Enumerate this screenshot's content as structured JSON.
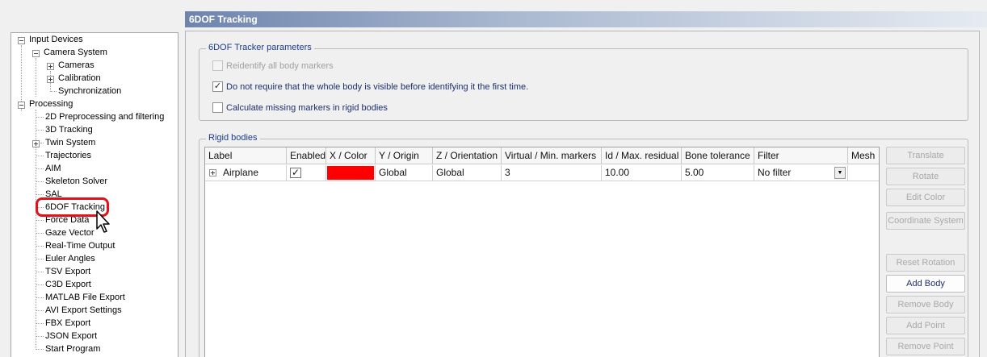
{
  "header": {
    "title": "6DOF Tracking"
  },
  "tree": {
    "input_devices": "Input Devices",
    "camera_system": "Camera System",
    "cameras": "Cameras",
    "calibration": "Calibration",
    "synchronization": "Synchronization",
    "processing": "Processing",
    "items": [
      "2D Preprocessing and filtering",
      "3D Tracking",
      "Twin System",
      "Trajectories",
      "AIM",
      "Skeleton Solver",
      "SAL",
      "6DOF Tracking",
      "Force Data",
      "Gaze Vector",
      "Real-Time Output",
      "Euler Angles",
      "TSV Export",
      "C3D Export",
      "MATLAB File Export",
      "AVI Export Settings",
      "FBX Export",
      "JSON Export",
      "Start Program"
    ],
    "selected": "6DOF Tracking"
  },
  "params": {
    "title": "6DOF Tracker parameters",
    "reidentify": "Reidentify all body markers",
    "no_require_visible": "Do not require that the whole body is visible before identifying it the first time.",
    "calc_missing": "Calculate missing markers in rigid bodies",
    "reidentify_checked": false,
    "no_require_visible_checked": true,
    "calc_missing_checked": false
  },
  "rigid": {
    "title": "Rigid bodies",
    "columns": [
      "Label",
      "Enabled",
      "X / Color",
      "Y / Origin",
      "Z / Orientation",
      "Virtual / Min. markers",
      "Id / Max. residual",
      "Bone tolerance",
      "Filter",
      "Mesh"
    ],
    "rows": [
      {
        "label": "Airplane",
        "enabled": "✓",
        "color": "#ff0000",
        "origin": "Global",
        "orientation": "Global",
        "min_markers": "3",
        "max_residual": "10.00",
        "bone_tolerance": "5.00",
        "filter": "No filter",
        "mesh": ""
      }
    ]
  },
  "buttons": {
    "translate": "Translate",
    "rotate": "Rotate",
    "edit_color": "Edit Color",
    "coordinate_system": "Coordinate System",
    "reset_rotation": "Reset Rotation",
    "add_body": "Add Body",
    "remove_body": "Remove Body",
    "add_point": "Add Point",
    "remove_point": "Remove Point"
  },
  "colors": {
    "header": "#6e84ad",
    "highlight": "#e0121c",
    "group_title": "#1c3b86"
  }
}
